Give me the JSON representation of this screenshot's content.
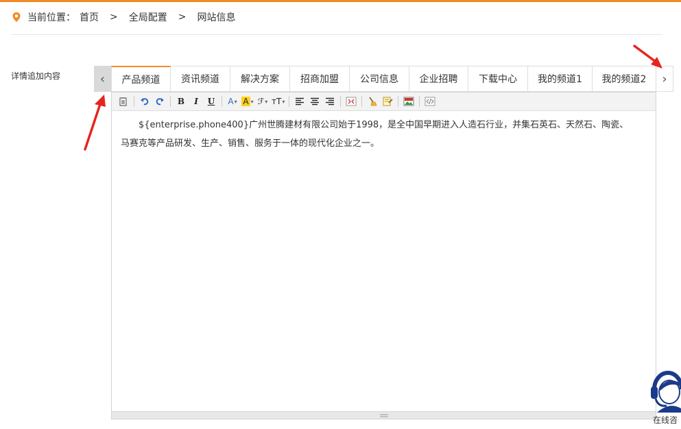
{
  "breadcrumb": {
    "prefix": "当前位置：",
    "items": [
      "首页",
      "全局配置",
      "网站信息"
    ],
    "separator": ">"
  },
  "field_label": "详情追加内容",
  "tabs": [
    {
      "label": "产品频道",
      "active": true
    },
    {
      "label": "资讯频道"
    },
    {
      "label": "解决方案"
    },
    {
      "label": "招商加盟"
    },
    {
      "label": "公司信息"
    },
    {
      "label": "企业招聘"
    },
    {
      "label": "下载中心"
    },
    {
      "label": "我的频道1"
    },
    {
      "label": "我的频道2"
    }
  ],
  "tab_prev_glyph": "‹",
  "tab_next_glyph": "›",
  "toolbar": {
    "paste_icon": "paste-icon",
    "undo_icon": "undo-icon",
    "redo_icon": "redo-icon",
    "bold": "B",
    "italic": "I",
    "underline": "U",
    "font_color": "A",
    "highlight": "A",
    "font_family": "ℱ",
    "font_size": "тT",
    "align_left_icon": "align-left-icon",
    "align_center_icon": "align-center-icon",
    "align_right_icon": "align-right-icon",
    "fullscreen_icon": "fullscreen-icon",
    "clear_format_icon": "broom-icon",
    "format_painter_icon": "format-painter-icon",
    "insert_image_icon": "image-icon",
    "source_icon": "source-code-icon"
  },
  "editor": {
    "content": "${enterprise.phone400}广州世腾建材有限公司始于1998，是全中国早期进入人造石行业，并集石英石、天然石、陶瓷、马赛克等产品研发、生产、销售、服务于一体的现代化企业之一。"
  },
  "cs_widget": {
    "label": "在线咨"
  },
  "colors": {
    "accent": "#f08a24",
    "arrow": "#e8231f",
    "cs_blue": "#1b3a8a"
  }
}
